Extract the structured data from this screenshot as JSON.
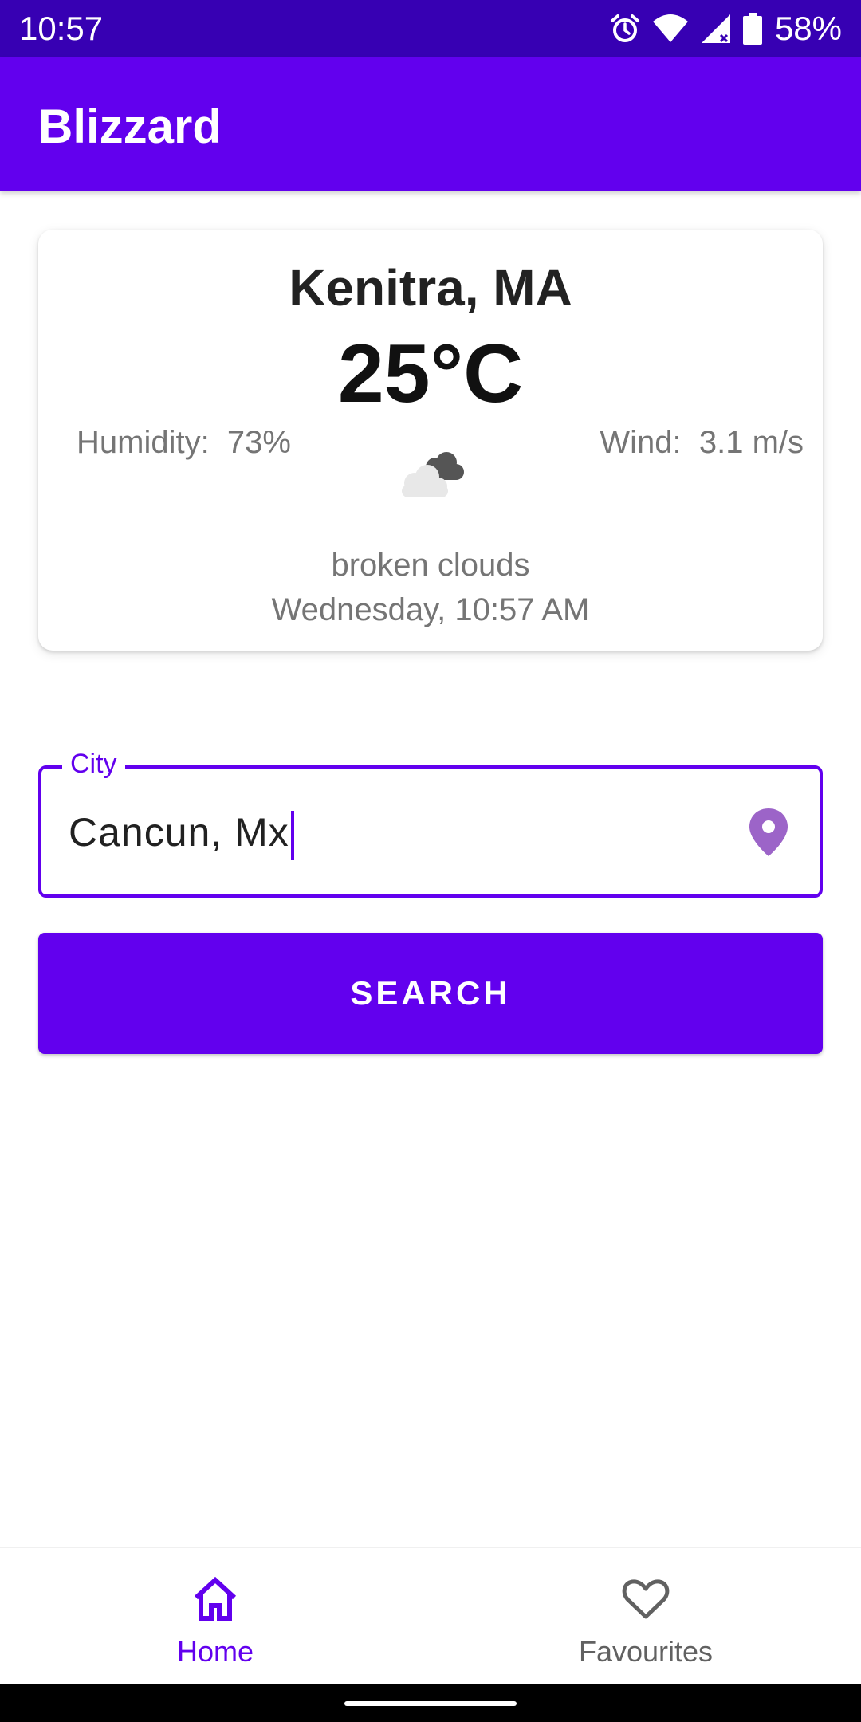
{
  "status_bar": {
    "time": "10:57",
    "battery_percent": "58%",
    "icons": [
      "alarm-icon",
      "wifi-icon",
      "cellular-signal-icon",
      "battery-icon"
    ]
  },
  "app_bar": {
    "title": "Blizzard"
  },
  "weather_card": {
    "city": "Kenitra, MA",
    "temperature": "25°C",
    "humidity": "Humidity:  73%",
    "wind": "Wind:  3.1 m/s",
    "icon": "broken-clouds-icon",
    "description": "broken clouds",
    "datetime": "Wednesday, 10:57 AM"
  },
  "city_input": {
    "label": "City",
    "value": "Cancun, Mx",
    "trailing_icon": "location-pin-icon"
  },
  "search_button": {
    "label": "SEARCH"
  },
  "bottom_nav": {
    "items": [
      {
        "label": "Home",
        "icon": "home-icon",
        "selected": true
      },
      {
        "label": "Favourites",
        "icon": "heart-icon",
        "selected": false
      }
    ]
  },
  "colors": {
    "primary": "#6200ee",
    "primary_dark": "#3700b3",
    "location_pin": "#9c64c8",
    "secondary_text": "#757575"
  }
}
